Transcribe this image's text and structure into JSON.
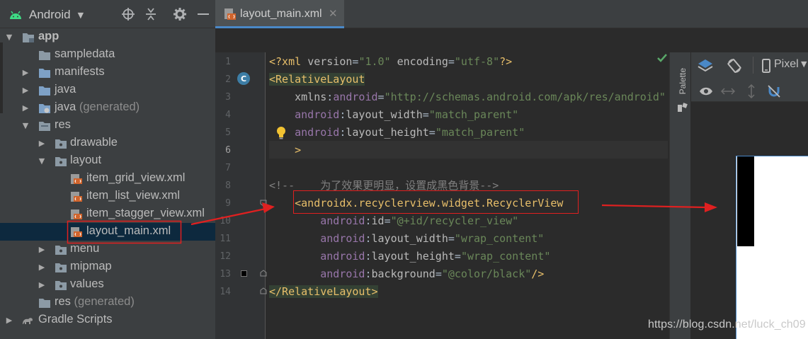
{
  "project_panel": {
    "view_selector": "Android",
    "header_icons": [
      "locate-icon",
      "collapse-icon",
      "gear-icon",
      "minimize-icon"
    ],
    "tree": [
      {
        "label": "app",
        "bold": true,
        "expanded": true,
        "icon": "module-folder-icon"
      },
      {
        "label": "sampledata",
        "icon": "folder-icon"
      },
      {
        "label": "manifests",
        "expanded": false,
        "icon": "folder-icon"
      },
      {
        "label": "java",
        "expanded": false,
        "icon": "folder-icon"
      },
      {
        "label": "java",
        "suffix": "(generated)",
        "expanded": false,
        "icon": "generated-folder-icon"
      },
      {
        "label": "res",
        "expanded": true,
        "icon": "res-folder-icon"
      },
      {
        "label": "drawable",
        "expanded": false,
        "icon": "package-folder-icon"
      },
      {
        "label": "layout",
        "expanded": true,
        "icon": "package-folder-icon"
      },
      {
        "label": "item_grid_view.xml",
        "icon": "layout-file-icon"
      },
      {
        "label": "item_list_view.xml",
        "icon": "layout-file-icon"
      },
      {
        "label": "item_stagger_view.xml",
        "icon": "layout-file-icon"
      },
      {
        "label": "layout_main.xml",
        "icon": "layout-file-icon",
        "selected": true
      },
      {
        "label": "menu",
        "expanded": false,
        "icon": "package-folder-icon"
      },
      {
        "label": "mipmap",
        "expanded": false,
        "icon": "package-folder-icon"
      },
      {
        "label": "values",
        "expanded": false,
        "icon": "package-folder-icon"
      },
      {
        "label": "res",
        "suffix": "(generated)",
        "icon": "generated-folder-icon"
      },
      {
        "label": "Gradle Scripts",
        "expanded": false,
        "icon": "gradle-icon"
      }
    ]
  },
  "editor": {
    "tab_label": "layout_main.xml",
    "line_numbers": [
      "1",
      "2",
      "3",
      "4",
      "5",
      "6",
      "7",
      "8",
      "9",
      "10",
      "11",
      "12",
      "13",
      "14"
    ],
    "lines": [
      {
        "parts": [
          [
            "pi",
            "<?xml "
          ],
          [
            "attr",
            "version"
          ],
          [
            "plain",
            "="
          ],
          [
            "val",
            "\"1.0\""
          ],
          [
            "plain",
            " "
          ],
          [
            "attr",
            "encoding"
          ],
          [
            "plain",
            "="
          ],
          [
            "val",
            "\"utf-8\""
          ],
          [
            "pi",
            "?>"
          ]
        ]
      },
      {
        "parts": [
          [
            "taghl",
            "<RelativeLayout"
          ]
        ]
      },
      {
        "parts": [
          [
            "plain",
            "    "
          ],
          [
            "attr",
            "xmlns"
          ],
          [
            "plain",
            ":"
          ],
          [
            "ns",
            "android"
          ],
          [
            "plain",
            "="
          ],
          [
            "val",
            "\"http://schemas.android.com/apk/res/android\""
          ]
        ]
      },
      {
        "parts": [
          [
            "plain",
            "    "
          ],
          [
            "ns",
            "android"
          ],
          [
            "plain",
            ":"
          ],
          [
            "attr",
            "layout_width"
          ],
          [
            "plain",
            "="
          ],
          [
            "val",
            "\"match_parent\""
          ]
        ]
      },
      {
        "parts": [
          [
            "plain",
            "    "
          ],
          [
            "ns",
            "android"
          ],
          [
            "plain",
            ":"
          ],
          [
            "attr",
            "layout_height"
          ],
          [
            "plain",
            "="
          ],
          [
            "val",
            "\"match_parent\""
          ]
        ]
      },
      {
        "parts": [
          [
            "plain",
            "    "
          ],
          [
            "tag",
            ">"
          ]
        ]
      },
      {
        "parts": []
      },
      {
        "parts": [
          [
            "cmt",
            "<!--    为了效果更明显，设置成黑色背景-->"
          ]
        ]
      },
      {
        "parts": [
          [
            "plain",
            "    "
          ],
          [
            "tag",
            "<androidx.recyclerview.widget.RecyclerView"
          ]
        ]
      },
      {
        "parts": [
          [
            "plain",
            "        "
          ],
          [
            "ns",
            "android"
          ],
          [
            "plain",
            ":"
          ],
          [
            "attr",
            "id"
          ],
          [
            "plain",
            "="
          ],
          [
            "val",
            "\"@+id/recycler_view\""
          ]
        ]
      },
      {
        "parts": [
          [
            "plain",
            "        "
          ],
          [
            "ns",
            "android"
          ],
          [
            "plain",
            ":"
          ],
          [
            "attr",
            "layout_width"
          ],
          [
            "plain",
            "="
          ],
          [
            "val",
            "\"wrap_content\""
          ]
        ]
      },
      {
        "parts": [
          [
            "plain",
            "        "
          ],
          [
            "ns",
            "android"
          ],
          [
            "plain",
            ":"
          ],
          [
            "attr",
            "layout_height"
          ],
          [
            "plain",
            "="
          ],
          [
            "val",
            "\"wrap_content\""
          ]
        ]
      },
      {
        "parts": [
          [
            "plain",
            "        "
          ],
          [
            "ns",
            "android"
          ],
          [
            "plain",
            ":"
          ],
          [
            "attr",
            "background"
          ],
          [
            "plain",
            "="
          ],
          [
            "val",
            "\"@color/black\""
          ],
          [
            "tag",
            "/>"
          ]
        ]
      },
      {
        "parts": [
          [
            "taghl",
            "</RelativeLayout>"
          ]
        ]
      }
    ],
    "gutter_badge": "C"
  },
  "palette": {
    "label": "Palette"
  },
  "preview": {
    "device": "Pixel"
  },
  "watermark": "https://blog.csdn.net/luck_ch09",
  "colors": {
    "accent": "#4a88c7",
    "annotation_red": "#e02020",
    "selection": "#0d293e"
  }
}
